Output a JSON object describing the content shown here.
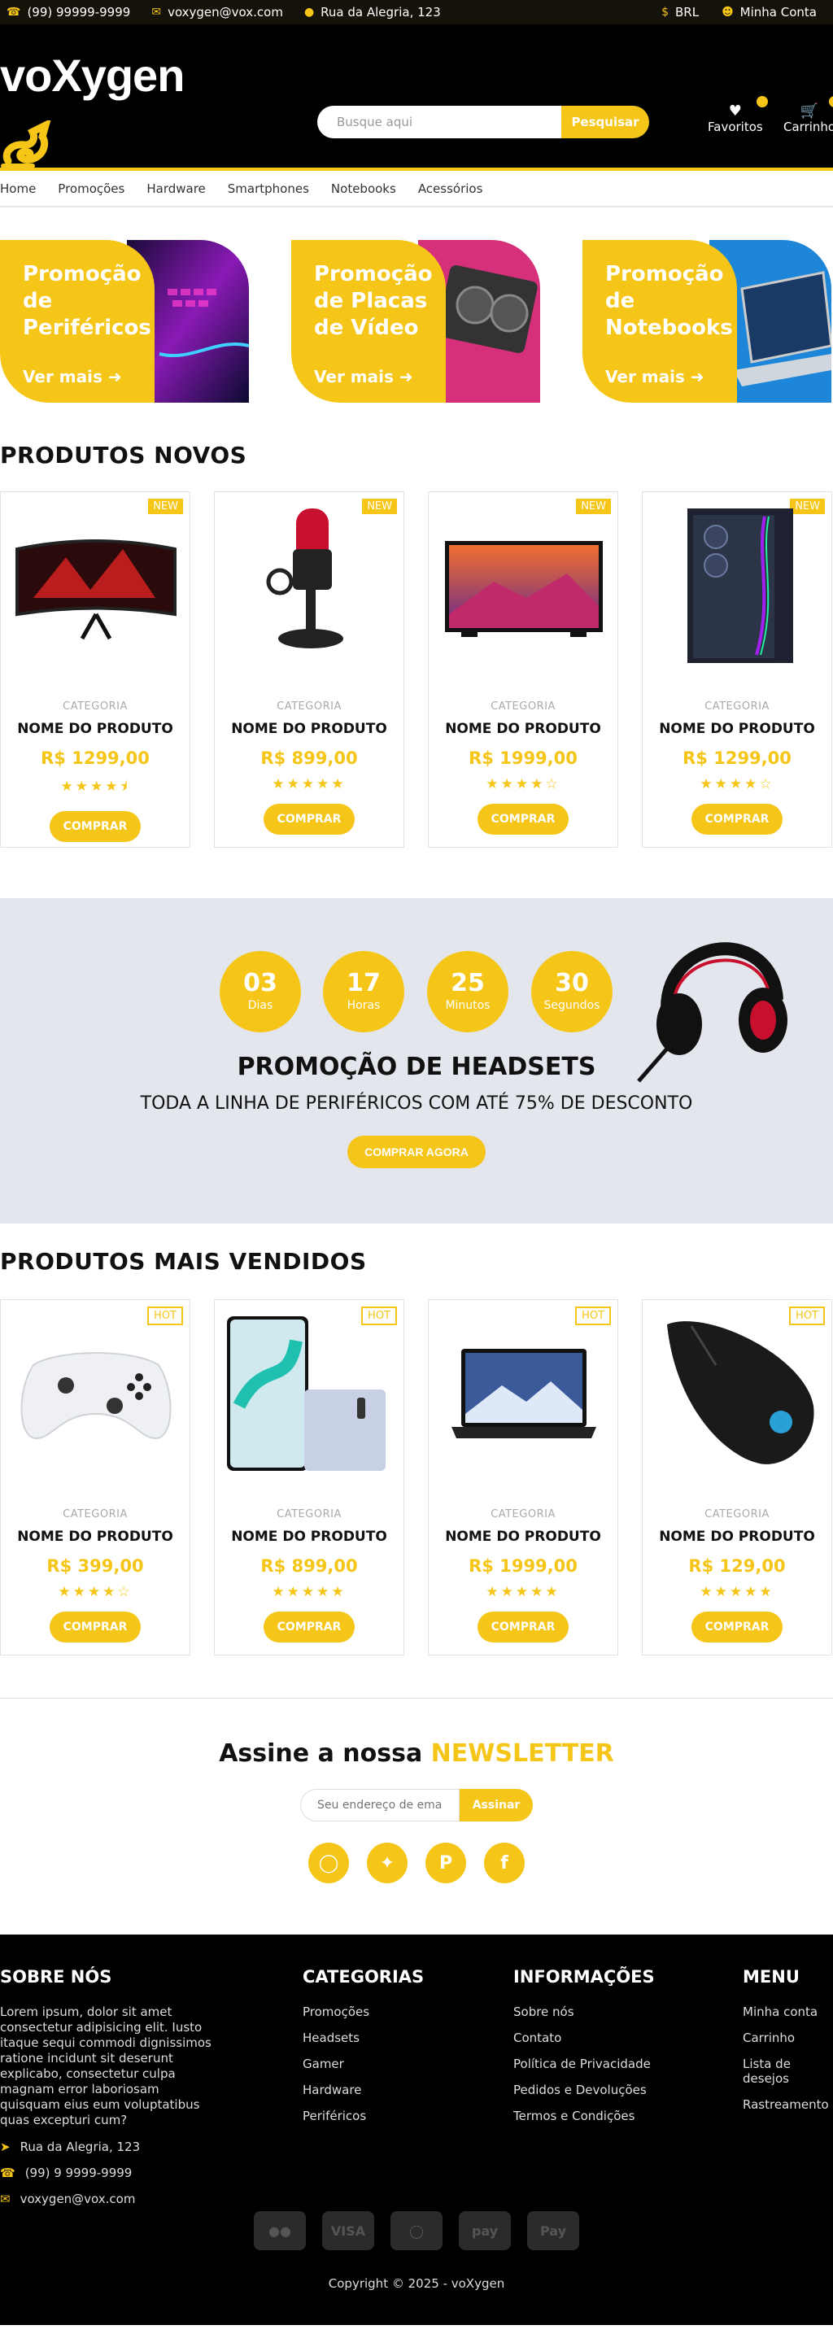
{
  "topbar": {
    "phone": "(99) 99999-9999",
    "email": "voxygen@vox.com",
    "address": "Rua da Alegria, 123",
    "currency": "BRL",
    "account": "Minha Conta"
  },
  "header": {
    "brand": "voXygen",
    "search_placeholder": "Busque aqui",
    "search_button": "Pesquisar",
    "favorites": "Favoritos",
    "cart": "Carrinho"
  },
  "nav": [
    "Home",
    "Promoções",
    "Hardware",
    "Smartphones",
    "Notebooks",
    "Acessórios"
  ],
  "promos": [
    {
      "title": "Promoção de Periféricos",
      "line1": "Promoção",
      "line2": "de",
      "line3": "Periféricos",
      "more": "Ver mais"
    },
    {
      "title": "Promoção de Placas de Vídeo",
      "line1": "Promoção",
      "line2": "de Placas",
      "line3": "de Vídeo",
      "more": "Ver mais"
    },
    {
      "title": "Promoção de Notebooks",
      "line1": "Promoção",
      "line2": "de",
      "line3": "Notebooks",
      "more": "Ver mais"
    }
  ],
  "new_products": {
    "title": "PRODUTOS NOVOS",
    "items": [
      {
        "tag": "NEW",
        "category": "CATEGORIA",
        "name": "NOME DO PRODUTO",
        "price": "R$ 1299,00",
        "rating": 4.5,
        "stars": "★★★★⯨",
        "button": "COMPRAR",
        "image": "monitor"
      },
      {
        "tag": "NEW",
        "category": "CATEGORIA",
        "name": "NOME DO PRODUTO",
        "price": "R$ 899,00",
        "rating": 5,
        "stars": "★★★★★",
        "button": "COMPRAR",
        "image": "microphone"
      },
      {
        "tag": "NEW",
        "category": "CATEGORIA",
        "name": "NOME DO PRODUTO",
        "price": "R$ 1999,00",
        "rating": 4,
        "stars": "★★★★☆",
        "button": "COMPRAR",
        "image": "tv"
      },
      {
        "tag": "NEW",
        "category": "CATEGORIA",
        "name": "NOME DO PRODUTO",
        "price": "R$ 1299,00",
        "rating": 4,
        "stars": "★★★★☆",
        "button": "COMPRAR",
        "image": "pc-case"
      }
    ]
  },
  "deal": {
    "countdown": [
      {
        "value": "03",
        "unit": "Dias"
      },
      {
        "value": "17",
        "unit": "Horas"
      },
      {
        "value": "25",
        "unit": "Minutos"
      },
      {
        "value": "30",
        "unit": "Segundos"
      }
    ],
    "title": "PROMOÇÃO DE HEADSETS",
    "subtitle": "TODA A LINHA DE PERIFÉRICOS COM ATÉ 75% DE DESCONTO",
    "button": "COMPRAR AGORA"
  },
  "best_sellers": {
    "title": "PRODUTOS MAIS VENDIDOS",
    "items": [
      {
        "tag": "HOT",
        "category": "CATEGORIA",
        "name": "NOME DO PRODUTO",
        "price": "R$ 399,00",
        "rating": 4,
        "stars": "★★★★☆",
        "button": "COMPRAR",
        "image": "controller"
      },
      {
        "tag": "HOT",
        "category": "CATEGORIA",
        "name": "NOME DO PRODUTO",
        "price": "R$ 899,00",
        "rating": 5,
        "stars": "★★★★★",
        "button": "COMPRAR",
        "image": "smartphone"
      },
      {
        "tag": "HOT",
        "category": "CATEGORIA",
        "name": "NOME DO PRODUTO",
        "price": "R$ 1999,00",
        "rating": 5,
        "stars": "★★★★★",
        "button": "COMPRAR",
        "image": "laptop"
      },
      {
        "tag": "HOT",
        "category": "CATEGORIA",
        "name": "NOME DO PRODUTO",
        "price": "R$ 129,00",
        "rating": 5,
        "stars": "★★★★★",
        "button": "COMPRAR",
        "image": "mouse"
      }
    ]
  },
  "newsletter": {
    "title_prefix": "Assine a nossa",
    "title_highlight": "NEWSLETTER",
    "placeholder": "Seu endereço de email",
    "button": "Assinar"
  },
  "social": [
    "instagram-icon",
    "twitter-icon",
    "pinterest-icon",
    "facebook-icon"
  ],
  "footer": {
    "about": {
      "title": "SOBRE NÓS",
      "text": "Lorem ipsum, dolor sit amet consectetur adipisicing elit. Iusto itaque sequi commodi dignissimos ratione incidunt sit deserunt explicabo, consectetur culpa magnam error laboriosam quisquam eius eum voluptatibus quas excepturi cum?",
      "address": "Rua da Alegria, 123",
      "phone": "(99) 9 9999-9999",
      "email": "voxygen@vox.com"
    },
    "categories": {
      "title": "CATEGORIAS",
      "links": [
        "Promoções",
        "Headsets",
        "Gamer",
        "Hardware",
        "Periféricos"
      ]
    },
    "info": {
      "title": "INFORMAÇÕES",
      "links": [
        "Sobre nós",
        "Contato",
        "Política de Privacidade",
        "Pedidos e Devoluções",
        "Termos e Condições"
      ]
    },
    "menu": {
      "title": "MENU",
      "links": [
        "Minha conta",
        "Carrinho",
        "Lista de desejos",
        "Rastreamento"
      ]
    },
    "payments": [
      "mastercard-icon",
      "visa-icon",
      "diners-icon",
      "paypal-icon",
      "apple-pay-icon"
    ],
    "copyright": "Copyright © 2025 - voXygen"
  },
  "colors": {
    "accent": "#f5c518",
    "dark": "#000000"
  }
}
